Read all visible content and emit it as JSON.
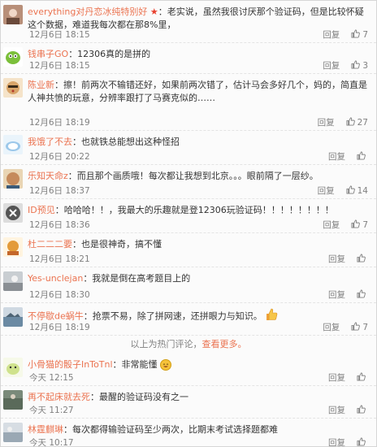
{
  "comments_hot": [
    {
      "id": "c1",
      "username": "everything对丹恋冰纯特别好",
      "badge": "star",
      "text": "：老实说，虽然我很讨厌那个验证码，但是比较怀疑这个数据，难道我每次都在那8%里，",
      "time": "12月6日 18:15",
      "reply_label": "回复",
      "likes": "7",
      "avatar_color": "#b88f79"
    },
    {
      "id": "c2",
      "username": "钱串子GO",
      "text": "：12306真的是拼的",
      "time": "12月6日 18:15",
      "reply_label": "回复",
      "likes": "3",
      "avatar_color": "#7bbf3a"
    },
    {
      "id": "c3",
      "username": "陈业新",
      "text": "：擦！前两次不输错还好，如果前两次错了，估计马会多好几个，妈的，简直是人神共愤的玩意，分辨率跟打了马赛克似的……",
      "time": "12月6日 18:19",
      "reply_label": "回复",
      "likes": "27",
      "avatar_color": "#d9a56a"
    },
    {
      "id": "c4",
      "username": "我饿了不去",
      "text": "：也就铁总能想出这种怪招",
      "time": "12月6日 20:22",
      "reply_label": "回复",
      "likes": "",
      "avatar_color": "#9cc8ea"
    },
    {
      "id": "c5",
      "username": "乐知天命z",
      "text": "：而且那个画质哦！每次都让我想到北京。。。眼前隔了一层纱。",
      "time": "12月6日 18:37",
      "reply_label": "回复",
      "likes": "14",
      "avatar_color": "#c58a5c"
    },
    {
      "id": "c6",
      "username": "ID预见",
      "text": "：哈哈哈！！，我最大的乐趣就是登12306玩验证码！！！！！！！！",
      "time": "12月6日 18:36",
      "reply_label": "回复",
      "likes": "7",
      "avatar_color": "#555555"
    },
    {
      "id": "c7",
      "username": "杜二二二要",
      "text": "：也是很神奇，搞不懂",
      "time": "12月6日 18:21",
      "reply_label": "回复",
      "likes": "",
      "avatar_color": "#e39b3a"
    },
    {
      "id": "c8",
      "username": "Yes-unclejan",
      "text": "：我就是倒在高考题目上的",
      "time": "12月6日 18:30",
      "reply_label": "回复",
      "likes": "",
      "avatar_color": "#8a8f94"
    },
    {
      "id": "c9",
      "username": "不停歇de蜗牛",
      "text": "：抢票不易，除了拼网速，还拼眼力与知识。",
      "time": "12月6日 18:19",
      "reply_label": "回复",
      "likes": "7",
      "avatar_color": "#6b8aa3",
      "trailing_emoji": "thumbs-up"
    }
  ],
  "hot_footer": {
    "text": "以上为热门评论，",
    "more_link": "查看更多。"
  },
  "comments_recent": [
    {
      "id": "c10",
      "username": "小骨猫的骰子InToTnl",
      "text": "：非常能懂",
      "time": "今天 12:15",
      "reply_label": "回复",
      "likes": "",
      "avatar_color": "#cfe28c",
      "trailing_emoji": "laugh"
    },
    {
      "id": "c11",
      "username": "再不起床就去死",
      "text": "：最醒的验证码没有之一",
      "time": "今天 11:27",
      "reply_label": "回复",
      "likes": "",
      "avatar_color": "#5a6a5a"
    },
    {
      "id": "c12",
      "username": "林霆麒琳",
      "text": "：每次都得输验证码至少两次，比期末考试选择题都难",
      "time": "今天 10:17",
      "reply_label": "回复",
      "likes": "",
      "avatar_color": "#9aa8b4"
    }
  ],
  "colors": {
    "username": "#eb7350",
    "text": "#333333",
    "meta": "#808080"
  }
}
